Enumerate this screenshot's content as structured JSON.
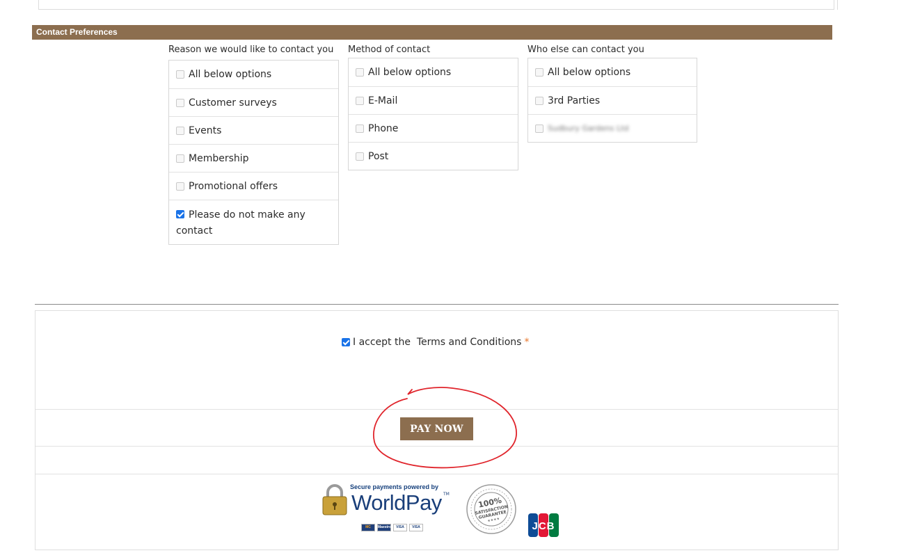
{
  "section_title": "Contact Preferences",
  "columns": [
    {
      "title": "Reason we would like to contact you",
      "options": [
        {
          "label": "All below options",
          "checked": false
        },
        {
          "label": "Customer surveys",
          "checked": false
        },
        {
          "label": "Events",
          "checked": false
        },
        {
          "label": "Membership",
          "checked": false
        },
        {
          "label": "Promotional offers",
          "checked": false
        },
        {
          "label": "Please do not make any contact",
          "checked": true
        }
      ]
    },
    {
      "title": "Method of contact",
      "options": [
        {
          "label": "All below options",
          "checked": false
        },
        {
          "label": "E-Mail",
          "checked": false
        },
        {
          "label": "Phone",
          "checked": false
        },
        {
          "label": "Post",
          "checked": false
        }
      ]
    },
    {
      "title": "Who else can contact you",
      "options": [
        {
          "label": "All below options",
          "checked": false
        },
        {
          "label": "3rd Parties",
          "checked": false
        },
        {
          "label": "Sudbury Gardens Ltd",
          "checked": false,
          "blurred": true
        }
      ]
    }
  ],
  "terms": {
    "label": "I accept the  Terms and Conditions",
    "required_mark": "*",
    "checked": true
  },
  "pay_button_label": "PAY NOW",
  "worldpay": {
    "caption": "Secure payments powered by",
    "name": "WorldPay",
    "tm": "TM",
    "cards": [
      "MC",
      "Maestro",
      "VISA",
      "VISA"
    ]
  },
  "seal": {
    "line1": "100%",
    "line2": "SATISFACTION",
    "line3": "GUARANTEE",
    "stars": "★★★★"
  },
  "jcb_label": "JCB",
  "colors": {
    "accent": "#8c6e4f",
    "checkbox": "#1a73e8",
    "required": "#e8762b",
    "annotation": "#e0242b"
  }
}
